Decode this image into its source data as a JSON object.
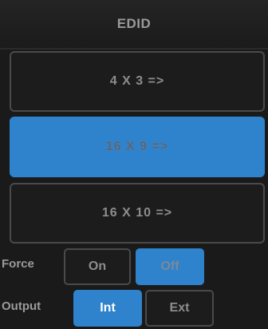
{
  "header": {
    "title": "EDID"
  },
  "edid_options": [
    {
      "label": "4 X 3 =>",
      "selected": false
    },
    {
      "label": "16 X 9 =>",
      "selected": true
    },
    {
      "label": "16 X 10 =>",
      "selected": false
    }
  ],
  "force": {
    "label": "Force",
    "on_label": "On",
    "off_label": "Off",
    "selected": "Off"
  },
  "output": {
    "label": "Output",
    "int_label": "Int",
    "ext_label": "Ext",
    "selected": "Int"
  },
  "colors": {
    "accent": "#2f82cc",
    "background": "#1a1a1a",
    "border": "#4a4a4a",
    "text": "#8d8d8d"
  }
}
